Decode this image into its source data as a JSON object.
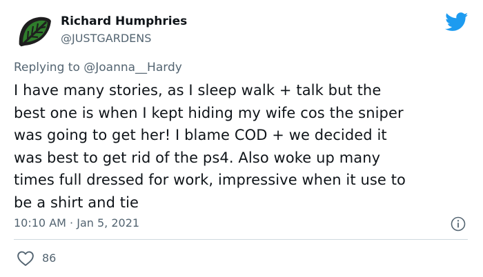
{
  "user": {
    "name": "Richard Humphries",
    "handle": "@JUSTGARDENS"
  },
  "reply": {
    "prefix": "Replying to",
    "handle": "@Joanna__Hardy"
  },
  "tweet": {
    "lines": [
      "I have many stories, as I sleep walk + talk but the",
      "best one is when I kept hiding my wife cos the sniper",
      "was going to get her! I blame COD + we decided it",
      "was best to get rid of the ps4. Also woke up many",
      "times full dressed for work, impressive when it use to",
      "be a shirt and tie"
    ]
  },
  "meta": {
    "time": "10:10 AM",
    "separator": "·",
    "date": "Jan 5, 2021"
  },
  "actions": {
    "like_count": "86"
  },
  "icons": {
    "avatar": "leaf-logo-icon",
    "brand": "twitter-bird-icon",
    "info": "info-icon",
    "like": "heart-icon"
  },
  "colors": {
    "twitter_blue": "#1d9bf0",
    "secondary_text": "#536471",
    "avatar_green": "#2f7d2c"
  }
}
